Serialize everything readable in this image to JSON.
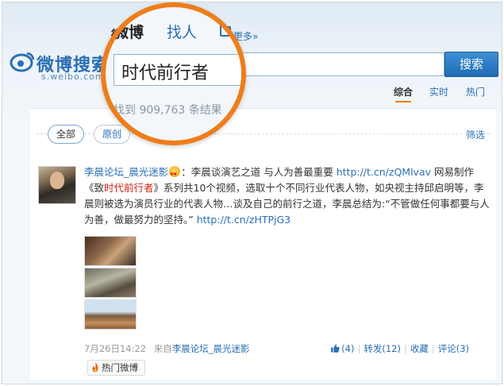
{
  "header": {
    "logo_text": "微博搜索",
    "logo_url": "s.weibo.com",
    "nav": {
      "weibo": "微博",
      "people": "找人",
      "more": "更多»"
    },
    "search_value": "时代前行者",
    "search_button": "搜索",
    "tabs": {
      "all": "综合",
      "realtime": "实时",
      "hot": "热门"
    },
    "result_text": "找到 909,763 条结果"
  },
  "filters": {
    "all": "全部",
    "original": "原创",
    "filter": "筛选"
  },
  "post": {
    "author": "李晨论坛_晨光迷影",
    "text_1": "：李晨谈演艺之道 与人为善最重要 ",
    "link_1": "http://t.cn/zQMlvav",
    "text_2": " 网易制作《致",
    "highlight": "时代前行者",
    "text_3": "》系列共10个视频，选取十个不同行业代表人物，如央视主持邱启明等，李晨则被选为演员行业的代表人物…谈及自己的前行之道，李晨总结为:“不管做任何事都要与人为善，做最努力的坚持。” ",
    "link_2": "http://t.cn/zHTPjG3",
    "time": "7月26日14:22",
    "source_prefix": "来自",
    "source": "李晨论坛_晨光迷影",
    "likes": "(4)",
    "repost": "转发(12)",
    "favorite": "收藏",
    "comment": "评论(3)",
    "hot_tag": "热门微博"
  },
  "colors": {
    "accent_blue": "#2a6fb5",
    "magnifier_ring": "#ef7d1a",
    "highlight_red": "#d2231a"
  }
}
